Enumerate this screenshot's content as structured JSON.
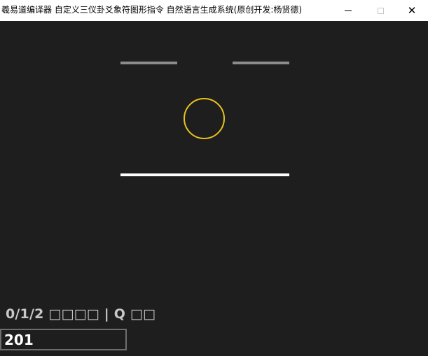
{
  "window": {
    "title": "羲易道编译器 自定义三仪卦爻象符图形指令 自然语言生成系统(原创开发:杨贤德)",
    "controls": {
      "minimize_icon": "minimize-icon",
      "maximize_icon": "maximize-icon",
      "close_icon": "close-icon",
      "close_glyph": "✕"
    }
  },
  "figure": {
    "top_line": {
      "type": "broken",
      "color": "#8c8c8c"
    },
    "middle_symbol": {
      "type": "circle",
      "color": "#e8c21e"
    },
    "bottom_line": {
      "type": "solid",
      "color": "#ffffff"
    }
  },
  "status": {
    "text": "0/1/2 □□□□ | Q □□"
  },
  "input": {
    "value": "201"
  }
}
